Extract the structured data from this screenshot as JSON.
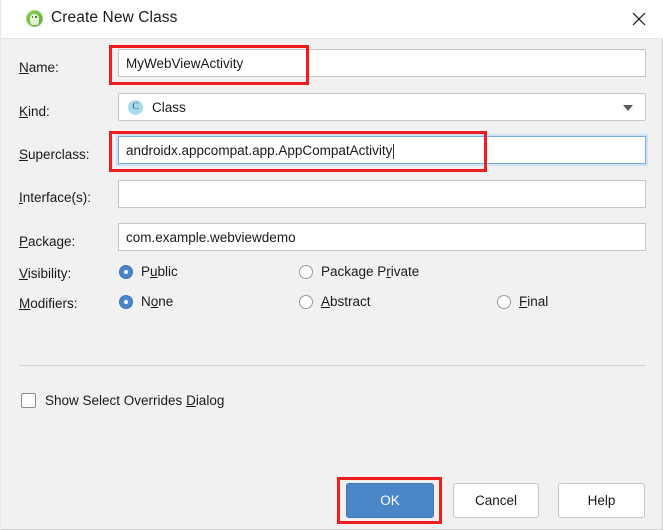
{
  "window": {
    "title": "Create New Class",
    "icon": "android-studio-icon",
    "close_icon": "close-icon"
  },
  "form": {
    "name": {
      "label": "Name:",
      "mnemonic": "N",
      "value": "MyWebViewActivity",
      "placeholder": ""
    },
    "kind": {
      "label": "Kind:",
      "mnemonic": "K",
      "value": "Class",
      "icon_letter": "C",
      "icon": "class-icon",
      "chevron": "chevron-down-icon",
      "options": [
        "Class"
      ]
    },
    "superclass": {
      "label": "Superclass:",
      "mnemonic": "S",
      "value": "androidx.appcompat.app.AppCompatActivity",
      "placeholder": "",
      "focused": true
    },
    "interfaces": {
      "label": "Interface(s):",
      "mnemonic": "I",
      "value": "",
      "placeholder": ""
    },
    "package": {
      "label": "Package:",
      "mnemonic": "P",
      "value": "com.example.webviewdemo",
      "placeholder": ""
    },
    "visibility": {
      "label": "Visibility:",
      "mnemonic": "V",
      "options": [
        {
          "label": "Public",
          "mnemonic": "u",
          "selected": true
        },
        {
          "label": "Package Private",
          "mnemonic": "r",
          "selected": false
        }
      ]
    },
    "modifiers": {
      "label": "Modifiers:",
      "mnemonic": "M",
      "options": [
        {
          "label": "None",
          "mnemonic": "o",
          "selected": true
        },
        {
          "label": "Abstract",
          "mnemonic": "A",
          "selected": false
        },
        {
          "label": "Final",
          "mnemonic": "F",
          "selected": false
        }
      ]
    },
    "show_overrides": {
      "label": "Show Select Overrides Dialog",
      "mnemonic": "D",
      "checked": false
    }
  },
  "footer": {
    "ok_label": "OK",
    "cancel_label": "Cancel",
    "help_label": "Help"
  },
  "annotations": {
    "accent_color": "#ef1d1d",
    "primary_color": "#4a86c8",
    "highlighted": [
      "name-field",
      "superclass-field",
      "ok-button"
    ]
  }
}
